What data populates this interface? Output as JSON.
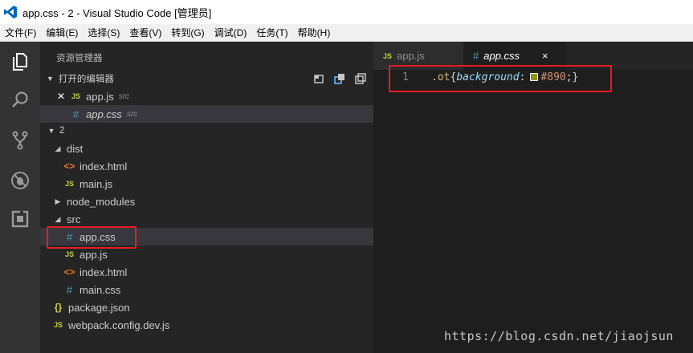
{
  "window": {
    "title": "app.css - 2 - Visual Studio Code [管理员]"
  },
  "menu": [
    "文件(F)",
    "编辑(E)",
    "选择(S)",
    "查看(V)",
    "转到(G)",
    "调试(D)",
    "任务(T)",
    "帮助(H)"
  ],
  "activity_bar": [
    "files-icon",
    "search-icon",
    "source-control-icon",
    "debug-icon",
    "extensions-icon"
  ],
  "sidebar": {
    "title": "资源管理器",
    "open_editors": {
      "header": "打开的编辑器",
      "items": [
        {
          "badge": "JS",
          "name": "app.js",
          "desc": "src"
        },
        {
          "badge": "#",
          "name": "app.css",
          "desc": "src"
        }
      ]
    },
    "tree": {
      "root": "2",
      "items": [
        {
          "label": "dist",
          "badge": ""
        },
        {
          "label": "index.html",
          "badge": "<>"
        },
        {
          "label": "main.js",
          "badge": "JS"
        },
        {
          "label": "node_modules",
          "badge": ""
        },
        {
          "label": "src",
          "badge": ""
        },
        {
          "label": "app.css",
          "badge": "#"
        },
        {
          "label": "app.js",
          "badge": "JS"
        },
        {
          "label": "index.html",
          "badge": "<>"
        },
        {
          "label": "main.css",
          "badge": "#"
        },
        {
          "label": "package.json",
          "badge": "{}"
        },
        {
          "label": "webpack.config.dev.js",
          "badge": "JS"
        }
      ]
    }
  },
  "tabs": [
    {
      "badge": "JS",
      "label": "app.js"
    },
    {
      "badge": "#",
      "label": "app.css",
      "close": "×"
    }
  ],
  "editor": {
    "line_number": "1",
    "tokens": {
      "selector": ".ot",
      "open_brace": "{",
      "property": "background",
      "colon": ":",
      "value": "#890",
      "close": ";}"
    },
    "swatch_color": "#889900"
  },
  "watermark": "https://blog.csdn.net/jiaojsun",
  "colors": {
    "highlight_box": "#e51c23",
    "activity_bar": "#333333",
    "sidebar": "#252526",
    "editor": "#1e1e1e"
  }
}
